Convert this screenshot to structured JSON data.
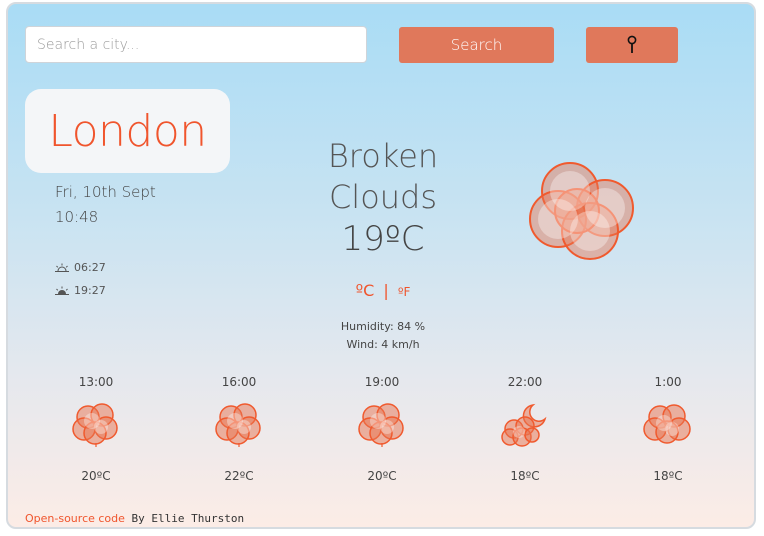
{
  "search": {
    "placeholder": "Search a city..."
  },
  "buttons": {
    "search_label": "Search",
    "locate_icon": "pin-icon"
  },
  "city": {
    "name": "London",
    "date": "Fri, 10th Sept",
    "time": "10:48"
  },
  "sun": {
    "sunrise": "06:27",
    "sunset": "19:27",
    "sunrise_icon": "sunrise-icon",
    "sunset_icon": "sunset-icon"
  },
  "current": {
    "description_line1": "Broken",
    "description_line2": "Clouds",
    "temperature": "19ºC",
    "icon": "broken-clouds-icon"
  },
  "units": {
    "celsius": "ºC",
    "separator": "|",
    "fahrenheit": "ºF"
  },
  "details": {
    "humidity": "Humidity: 84 %",
    "wind": "Wind: 4 km/h"
  },
  "forecast": [
    {
      "hour": "13:00",
      "temp": "20ºC",
      "icon": "cloud-icon"
    },
    {
      "hour": "16:00",
      "temp": "22ºC",
      "icon": "cloud-icon"
    },
    {
      "hour": "19:00",
      "temp": "20ºC",
      "icon": "cloud-icon"
    },
    {
      "hour": "22:00",
      "temp": "18ºC",
      "icon": "cloud-moon-icon"
    },
    {
      "hour": "1:00",
      "temp": "18ºC",
      "icon": "cloud-icon"
    }
  ],
  "footer": {
    "link_text": "Open-source code",
    "author_text": " By Ellie Thurston"
  },
  "colors": {
    "accent": "#f0552d",
    "button": "#e0785b",
    "cloud": "#e8744f"
  }
}
